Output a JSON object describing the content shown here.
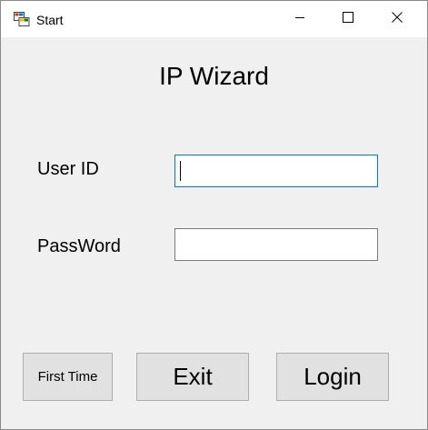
{
  "window": {
    "title": "Start",
    "app_icon": "winforms-app-icon",
    "controls": {
      "minimize_icon": "minimize-icon",
      "maximize_icon": "maximize-icon",
      "close_icon": "close-icon"
    }
  },
  "form": {
    "heading": "IP Wizard",
    "user_id_label": "User ID",
    "user_id_value": "",
    "password_label": "PassWord",
    "password_value": ""
  },
  "buttons": {
    "first_time": "First Time",
    "exit": "Exit",
    "login": "Login"
  },
  "colors": {
    "window_bg": "#f0f0f0",
    "titlebar_bg": "#ffffff",
    "focus_border": "#0078d7",
    "button_bg": "#e1e1e1"
  }
}
